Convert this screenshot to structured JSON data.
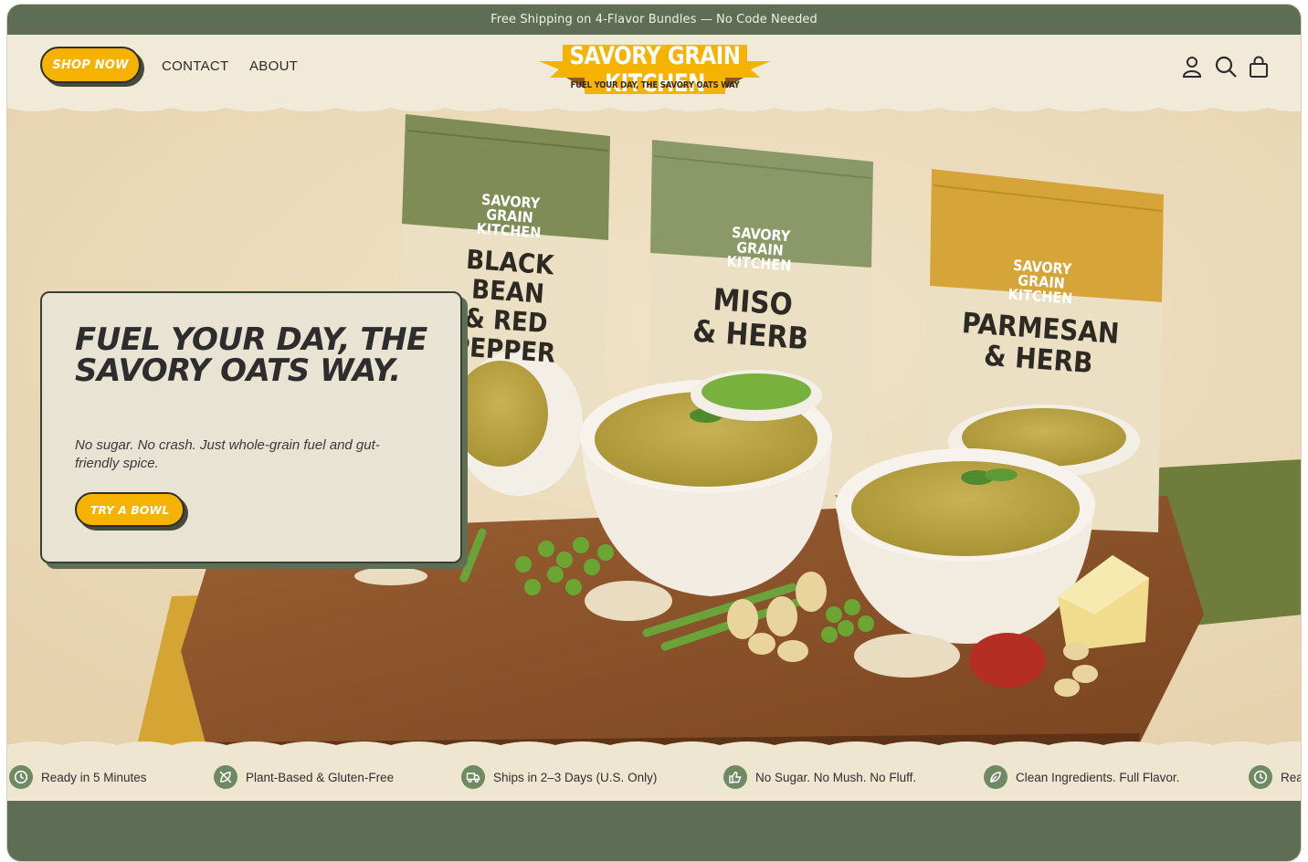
{
  "announcement": {
    "text": "Free Shipping on 4-Flavor Bundles — No Code Needed"
  },
  "header": {
    "shop_now_label": "SHOP NOW",
    "nav": {
      "contact": "CONTACT",
      "about": "ABOUT"
    },
    "logo": {
      "title": "SAVORY GRAIN KITCHEN",
      "tagline": "FUEL YOUR DAY, THE SAVORY OATS WAY"
    },
    "icons": [
      "account-icon",
      "search-icon",
      "cart-icon"
    ]
  },
  "hero": {
    "title": "FUEL YOUR DAY, THE SAVORY OATS WAY.",
    "subtitle": "No sugar. No crash. Just whole-grain fuel and gut-friendly spice.",
    "cta_label": "TRY A BOWL",
    "pouches": [
      {
        "brand_line1": "SAVORY GRAIN",
        "brand_line2": "KITCHEN",
        "flavor_line1": "BLACK BEAN",
        "flavor_line2": "& RED PEPPER",
        "color": "#7f8c55"
      },
      {
        "brand_line1": "SAVORY GRAIN",
        "brand_line2": "KITCHEN",
        "flavor_line1": "MISO",
        "flavor_line2": "& HERB",
        "color": "#8b9968"
      },
      {
        "brand_line1": "SAVORY GRAIN",
        "brand_line2": "KITCHEN",
        "flavor_line1": "PARMESAN",
        "flavor_line2": "& HERB",
        "color": "#d6a53a"
      }
    ]
  },
  "features": [
    {
      "icon": "clock-icon",
      "label": "Ready in 5 Minutes"
    },
    {
      "icon": "leaf-slash-icon",
      "label": "Plant-Based & Gluten-Free"
    },
    {
      "icon": "truck-icon",
      "label": "Ships in 2–3 Days (U.S. Only)"
    },
    {
      "icon": "thumbs-up-icon",
      "label": "No Sugar. No Mush. No Fluff."
    },
    {
      "icon": "leaf-icon",
      "label": "Clean Ingredients. Full Flavor."
    },
    {
      "icon": "clock-icon",
      "label": "Rea"
    }
  ],
  "colors": {
    "brand_green": "#5d6e55",
    "accent_yellow": "#f5b300",
    "cream": "#f2ead9"
  }
}
